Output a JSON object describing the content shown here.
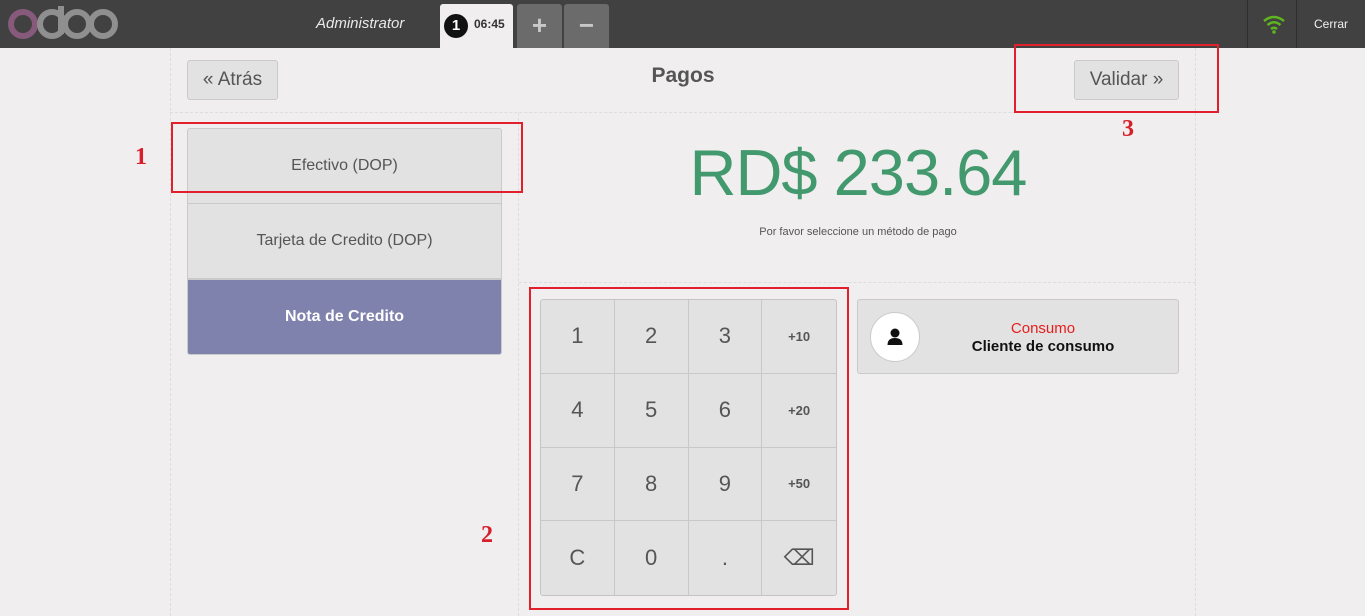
{
  "topbar": {
    "logo_text": "odoo",
    "user_name": "Administrator",
    "order_number": "1",
    "order_time": "06:45",
    "add_order": "+",
    "remove_order": "−",
    "close_label": "Cerrar"
  },
  "header": {
    "back_label": "« Atrás",
    "title": "Pagos",
    "validate_label": "Validar »"
  },
  "payment_methods": [
    {
      "label": "Efectivo (DOP)"
    },
    {
      "label": "Tarjeta de Credito (DOP)"
    },
    {
      "label": "Nota de Credito"
    }
  ],
  "payment": {
    "amount": "RD$ 233.64",
    "hint": "Por favor seleccione un método de pago"
  },
  "numpad": {
    "keys": [
      "1",
      "2",
      "3",
      "+10",
      "4",
      "5",
      "6",
      "+20",
      "7",
      "8",
      "9",
      "+50",
      "C",
      "0",
      ".",
      "⌫"
    ]
  },
  "customer": {
    "line1": "Consumo",
    "line2": "Cliente de consumo"
  },
  "annotations": [
    "1",
    "2",
    "3"
  ],
  "colors": {
    "topbar": "#414141",
    "logo_o": "#875a7b",
    "logo_rest": "#8f8f8f",
    "amount": "#43996e",
    "selected_method": "#7f82ac",
    "customer_highlight": "#e81c1c",
    "annotation": "#e2202b",
    "wifi": "#5fb51e"
  }
}
